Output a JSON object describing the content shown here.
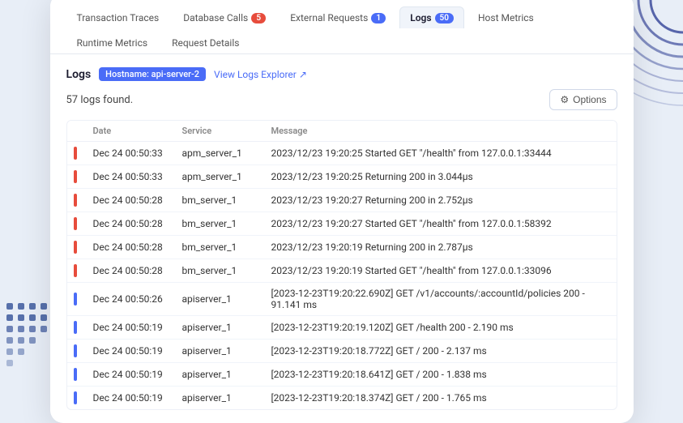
{
  "tabs": [
    {
      "id": "transaction-traces",
      "label": "Transaction Traces",
      "badge": null,
      "active": false
    },
    {
      "id": "database-calls",
      "label": "Database Calls",
      "badge": "5",
      "badgeColor": "red",
      "active": false
    },
    {
      "id": "external-requests",
      "label": "External Requests",
      "badge": "1",
      "badgeColor": "default",
      "active": false
    },
    {
      "id": "logs",
      "label": "Logs",
      "badge": "50",
      "badgeColor": "default",
      "active": true
    },
    {
      "id": "host-metrics",
      "label": "Host Metrics",
      "badge": null,
      "active": false
    },
    {
      "id": "runtime-metrics",
      "label": "Runtime Metrics",
      "badge": null,
      "active": false
    },
    {
      "id": "request-details",
      "label": "Request Details",
      "badge": null,
      "active": false
    }
  ],
  "logs": {
    "section_title": "Logs",
    "hostname_badge": "Hostname: api-server-2",
    "view_logs_link": "View Logs Explorer",
    "logs_count": "57 logs found.",
    "options_button": "Options",
    "columns": [
      "Date",
      "Service",
      "Message"
    ],
    "rows": [
      {
        "date": "Dec 24 00:50:33",
        "service": "apm_server_1",
        "message": "2023/12/23 19:20:25 Started GET \"/health\" from 127.0.0.1:33444",
        "indicator": "red"
      },
      {
        "date": "Dec 24 00:50:33",
        "service": "apm_server_1",
        "message": "2023/12/23 19:20:25 Returning 200 in 3.044μs",
        "indicator": "red"
      },
      {
        "date": "Dec 24 00:50:28",
        "service": "bm_server_1",
        "message": "2023/12/23 19:20:27 Returning 200 in 2.752μs",
        "indicator": "red"
      },
      {
        "date": "Dec 24 00:50:28",
        "service": "bm_server_1",
        "message": "2023/12/23 19:20:27 Started GET \"/health\" from 127.0.0.1:58392",
        "indicator": "red"
      },
      {
        "date": "Dec 24 00:50:28",
        "service": "bm_server_1",
        "message": "2023/12/23 19:20:19 Returning 200 in 2.787μs",
        "indicator": "red"
      },
      {
        "date": "Dec 24 00:50:28",
        "service": "bm_server_1",
        "message": "2023/12/23 19:20:19 Started GET \"/health\" from 127.0.0.1:33096",
        "indicator": "red"
      },
      {
        "date": "Dec 24 00:50:26",
        "service": "apiserver_1",
        "message": "[2023-12-23T19:20:22.690Z] GET /v1/accounts/:accountId/policies 200 - 91.141 ms",
        "indicator": "blue"
      },
      {
        "date": "Dec 24 00:50:19",
        "service": "apiserver_1",
        "message": "[2023-12-23T19:20:19.120Z] GET /health 200 - 2.190 ms",
        "indicator": "blue"
      },
      {
        "date": "Dec 24 00:50:19",
        "service": "apiserver_1",
        "message": "[2023-12-23T19:20:18.772Z] GET / 200 - 2.137 ms",
        "indicator": "blue"
      },
      {
        "date": "Dec 24 00:50:19",
        "service": "apiserver_1",
        "message": "[2023-12-23T19:20:18.641Z] GET / 200 - 1.838 ms",
        "indicator": "blue"
      },
      {
        "date": "Dec 24 00:50:19",
        "service": "apiserver_1",
        "message": "[2023-12-23T19:20:18.374Z] GET / 200 - 1.765 ms",
        "indicator": "blue"
      }
    ]
  }
}
